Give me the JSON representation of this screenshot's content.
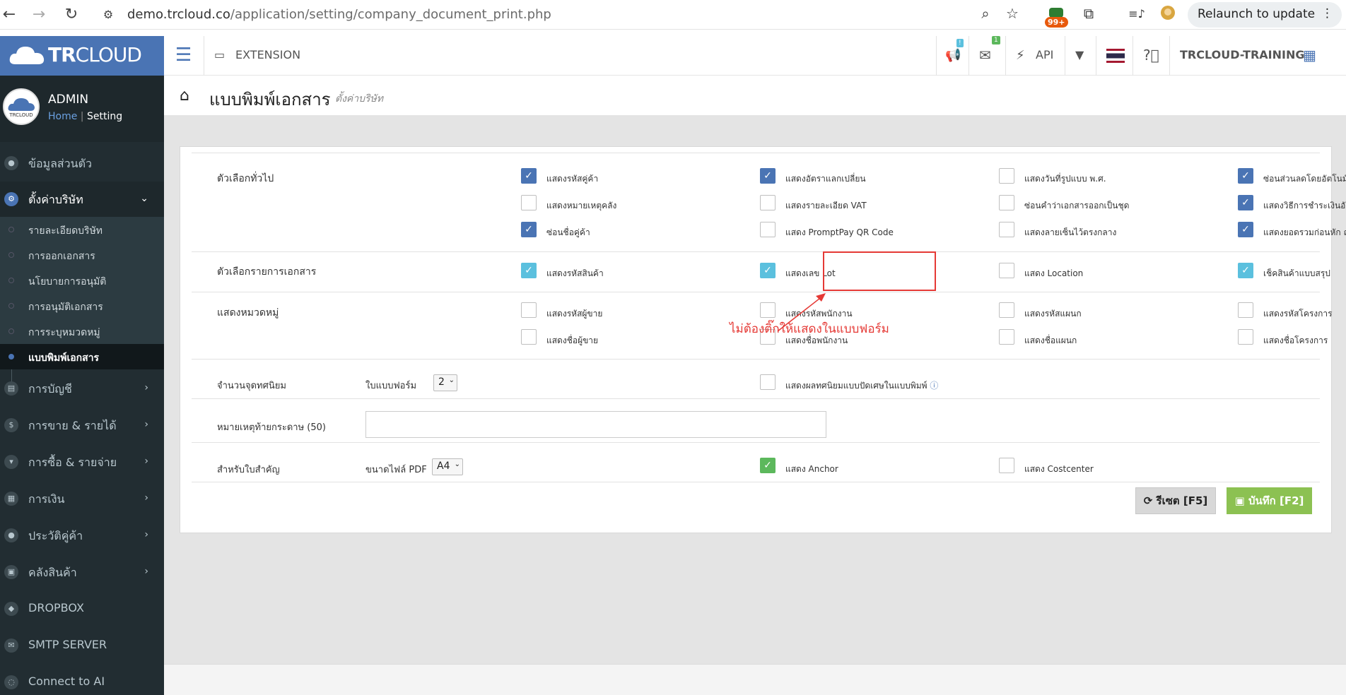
{
  "browser": {
    "url_host": "demo.trcloud.co",
    "url_path": "/application/setting/company_document_print.php",
    "ext_badge": "99+",
    "relaunch_label": "Relaunch to update"
  },
  "sidebar": {
    "logo_bold": "TR",
    "logo_light": "CLOUD",
    "avatar_text": "TRCLOUD",
    "user_name": "ADMIN",
    "crumb_home": "Home",
    "crumb_sep": "|",
    "crumb_current": "Setting",
    "items": [
      {
        "label": "ข้อมูลส่วนตัว",
        "icon": "user-icon"
      },
      {
        "label": "ตั้งค่าบริษัท",
        "icon": "gear-icon"
      },
      {
        "label": "การบัญชี",
        "icon": "book-icon"
      },
      {
        "label": "การขาย & รายได้",
        "icon": "dollar-icon"
      },
      {
        "label": "การซื้อ & รายจ่าย",
        "icon": "cart-icon"
      },
      {
        "label": "การเงิน",
        "icon": "calendar-icon"
      },
      {
        "label": "ประวัติคู่ค้า",
        "icon": "user-icon"
      },
      {
        "label": "คลังสินค้า",
        "icon": "box-icon"
      },
      {
        "label": "DROPBOX",
        "icon": "dropbox-icon"
      },
      {
        "label": "SMTP SERVER",
        "icon": "envelope-icon"
      },
      {
        "label": "Connect to AI",
        "icon": "chat-icon"
      }
    ],
    "sub_items": [
      "รายละเอียดบริษัท",
      "การออกเอกสาร",
      "นโยบายการอนุมัติ",
      "การอนุมัติเอกสาร",
      "การระบุหมวดหมู่",
      "แบบพิมพ์เอกสาร"
    ]
  },
  "topnav": {
    "extension_label": "EXTENSION",
    "megaphone_badge": "!",
    "mail_badge": "1",
    "api_label": "API",
    "company_label": "TRCLOUD-TRAINING"
  },
  "page": {
    "title": "แบบพิมพ์เอกสาร",
    "subtitle": "ตั้งค่าบริษัท"
  },
  "form": {
    "general_label": "ตัวเลือกทั่วไป",
    "general_options": [
      "แสดงรหัสคู่ค้า",
      "แสดงอัตราแลกเปลี่ยน",
      "แสดงวันที่รูปแบบ พ.ศ.",
      "ซ่อนส่วนลดโดยอัตโนมัติ",
      "แสดงหมายเหตุคลัง",
      "แสดงรายละเอียด VAT",
      "ซ่อนคำว่าเอกสารออกเป็นชุด",
      "แสดงวิธีการชำระเงินอัตโนมัติ",
      "ซ่อนชื่อคู่ค้า",
      "แสดง PromptPay QR Code",
      "แสดงลายเซ็นไว้ตรงกลาง",
      "แสดงยอดรวมก่อนหัก ณ ที่จ่าย"
    ],
    "doc_label": "ตัวเลือกรายการเอกสาร",
    "doc_options": [
      "แสดงรหัสสินค้า",
      "แสดงเลข Lot",
      "แสดง Location",
      "เช็คสินค้าแบบสรุป"
    ],
    "category_label": "แสดงหมวดหมู่",
    "category_options": [
      "แสดงรหัสผู้ขาย",
      "แสดงรหัสพนักงาน",
      "แสดงรหัสแผนก",
      "แสดงรหัสโครงการ",
      "แสดงชื่อผู้ขาย",
      "แสดงชื่อพนักงาน",
      "แสดงชื่อแผนก",
      "แสดงชื่อโครงการ"
    ],
    "decimal_label": "จำนวนจุดทศนิยม",
    "decimal_form_label": "ใบแบบฟอร์ม",
    "decimal_value": "2",
    "decimal_option": "แสดงผลทศนิยมแบบปัดเศษในแบบพิมพ์",
    "note_label": "หมายเหตุท้ายกระดาษ (50)",
    "note_value": "",
    "important_label": "สำหรับใบสำคัญ",
    "pdf_size_label": "ขนาดไฟล์ PDF",
    "pdf_size_value": "A4",
    "anchor_option": "แสดง Anchor",
    "costcenter_option": "แสดง Costcenter",
    "annotation": "ไม่ต้องติ๊กให้แสดงในแบบฟอร์ม",
    "reset_label": "รีเซต [F5]",
    "save_label": "บันทึก [F2]"
  },
  "colors": {
    "accent": "#4a74b4",
    "sidebar_bg": "#222d32",
    "save_green": "#8cc152",
    "annotation_red": "#e53935"
  }
}
